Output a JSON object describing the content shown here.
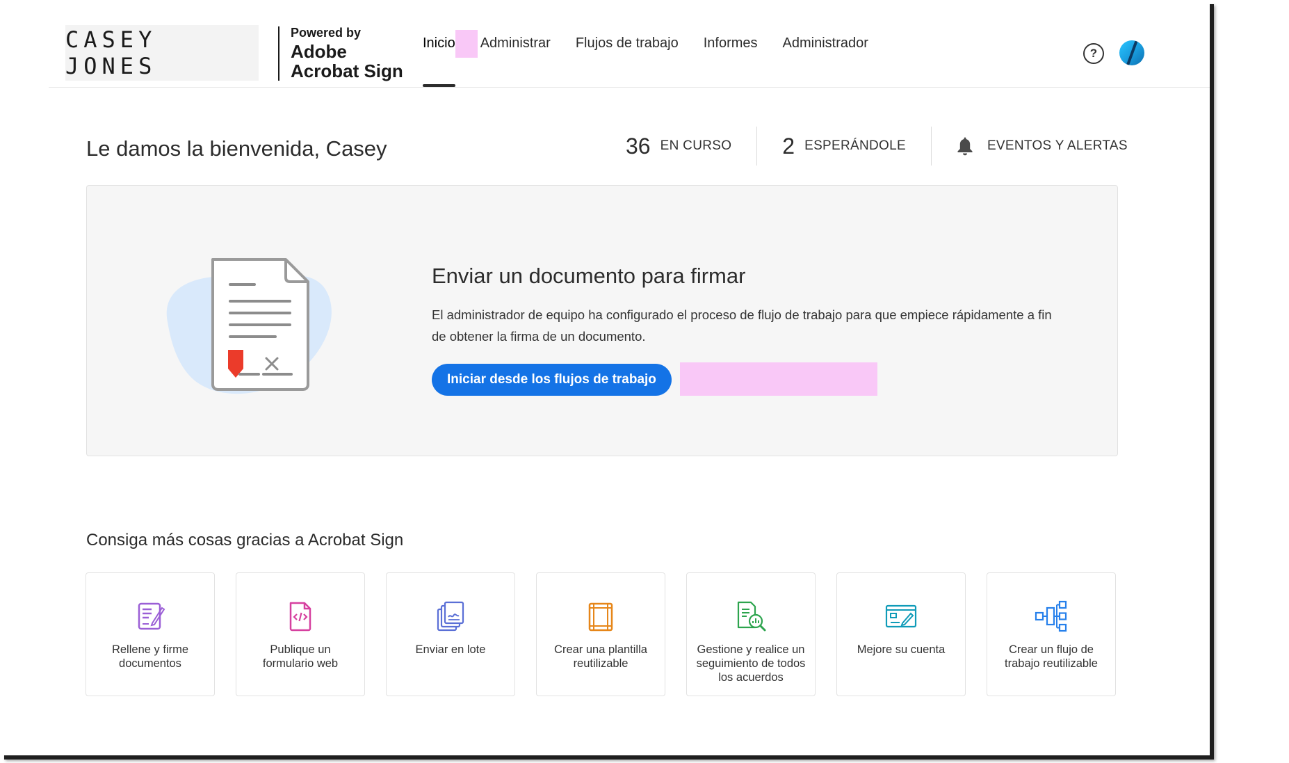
{
  "header": {
    "brand_name": "CASEY JONES",
    "powered_by": "Powered by",
    "product_line1": "Adobe",
    "product_line2": "Acrobat Sign",
    "nav": [
      "Inicio",
      "Administrar",
      "Flujos de trabajo",
      "Informes",
      "Administrador"
    ],
    "active_nav": "Inicio",
    "help_glyph": "?"
  },
  "welcome": {
    "greeting": "Le damos la bienvenida, Casey",
    "stats": [
      {
        "count": "36",
        "label": "EN CURSO"
      },
      {
        "count": "2",
        "label": "ESPERÁNDOLE"
      }
    ],
    "events_label": "EVENTOS Y ALERTAS"
  },
  "hero": {
    "title": "Enviar un documento para firmar",
    "description": "El administrador de equipo ha configurado el proceso de flujo de trabajo para que empiece rápidamente a fin de obtener la firma de un documento.",
    "button_label": "Iniciar desde los flujos de trabajo"
  },
  "more": {
    "title": "Consiga más cosas gracias a Acrobat Sign",
    "cards": [
      {
        "label": "Rellene y firme documentos",
        "icon": "fill-sign-icon",
        "color": "#9b5fd6"
      },
      {
        "label": "Publique un formulario web",
        "icon": "web-form-icon",
        "color": "#d6409f"
      },
      {
        "label": "Enviar en lote",
        "icon": "bulk-send-icon",
        "color": "#5a6fd6"
      },
      {
        "label": "Crear una plantilla reutilizable",
        "icon": "template-icon",
        "color": "#e68619"
      },
      {
        "label": "Gestione y realice un seguimiento de todos los acuerdos",
        "icon": "track-agreements-icon",
        "color": "#2da44e"
      },
      {
        "label": "Mejore su cuenta",
        "icon": "upgrade-account-icon",
        "color": "#0f9bb8"
      },
      {
        "label": "Crear un flujo de trabajo reutilizable",
        "icon": "workflow-icon",
        "color": "#2680eb"
      }
    ]
  },
  "colors": {
    "accent": "#1473e6",
    "redaction": "#f9c8f7",
    "hero_bg": "#f6f6f6"
  }
}
